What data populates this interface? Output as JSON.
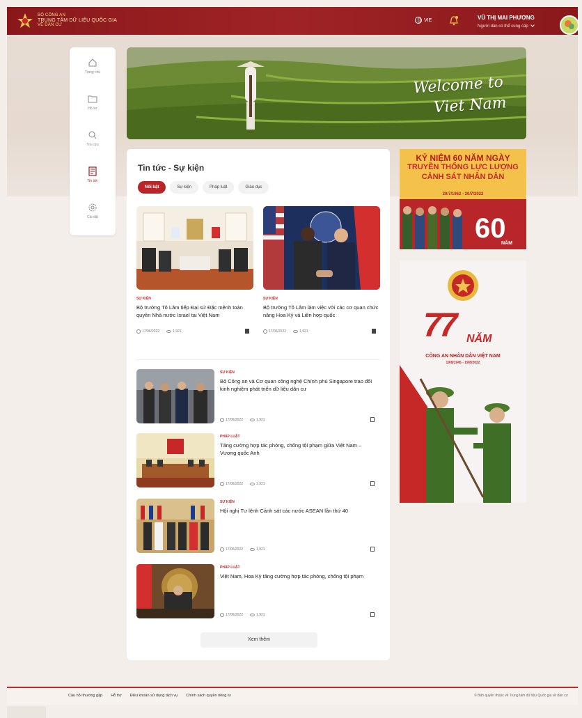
{
  "header": {
    "org_line1": "BỘ CÔNG AN",
    "org_line2": "TRUNG TÂM DỮ LIỆU QUỐC GIA",
    "org_line3": "VỀ DÂN CƯ",
    "language": "VIE",
    "user_name": "VŨ THỊ MAI PHƯƠNG",
    "user_role": "Người dân có thể cung cấp"
  },
  "sidebar": {
    "items": [
      {
        "label": "Trang chủ",
        "icon": "home-icon"
      },
      {
        "label": "Hồ sơ",
        "icon": "folder-icon"
      },
      {
        "label": "Tra cứu",
        "icon": "search-icon"
      },
      {
        "label": "Tin tức",
        "icon": "news-icon"
      },
      {
        "label": "Cài đặt",
        "icon": "gear-icon"
      }
    ]
  },
  "hero": {
    "line1": "Welcome to",
    "line2": "Viet Nam"
  },
  "news": {
    "title": "Tin tức - Sự kiện",
    "tabs": [
      "Nổi bật",
      "Sự kiện",
      "Pháp luật",
      "Giáo dục"
    ],
    "featured": [
      {
        "tag": "SỰ KIỆN",
        "title": "Bộ trưởng Tô Lâm tiếp Đại sứ Đặc mệnh toàn quyền Nhà nước Israel tại Việt Nam",
        "date": "17/06/2022",
        "views": "1,921"
      },
      {
        "tag": "SỰ KIỆN",
        "title": "Bộ trưởng Tô Lâm làm việc với các cơ quan chức năng Hoa Kỳ và Liên hợp quốc",
        "date": "17/06/2022",
        "views": "1,921"
      }
    ],
    "list": [
      {
        "tag": "SỰ KIỆN",
        "title": "Bộ Công an và Cơ quan công nghệ Chính phủ Singapore trao đổi kinh nghiệm phát triển dữ liệu dân cư",
        "date": "17/06/2022",
        "views": "1,921"
      },
      {
        "tag": "PHÁP LUẬT",
        "title": "Tăng cường hợp tác phòng, chống tội phạm giữa Việt Nam – Vương quốc Anh",
        "date": "17/06/2022",
        "views": "1,921"
      },
      {
        "tag": "SỰ KIỆN",
        "title": "Hội nghị Tư lệnh Cảnh sát các nước ASEAN lần thứ 40",
        "date": "17/06/2022",
        "views": "1,921"
      },
      {
        "tag": "PHÁP LUẬT",
        "title": "Việt Nam, Hoa Kỳ tăng cường hợp tác phòng, chống tội phạm",
        "date": "17/06/2022",
        "views": "1,921"
      }
    ],
    "more_label": "Xem thêm"
  },
  "ads": {
    "ad1": {
      "line1": "KỶ NIỆM 60 NĂM NGÀY",
      "line2": "TRUYỀN THỐNG LỰC LƯỢNG",
      "line3": "CẢNH SÁT NHÂN DÂN",
      "dates": "20/7/1962 - 20/7/2022",
      "number": "60",
      "unit": "NĂM"
    },
    "ad2": {
      "number": "77",
      "unit": "NĂM",
      "subtitle": "CÔNG AN NHÂN DÂN VIỆT NAM",
      "dates": "19/8/1945 - 19/8/2022"
    }
  },
  "footer": {
    "links": [
      "Câu hỏi thường gặp",
      "Hỗ trợ",
      "Điều khoản sử dụng dịch vụ",
      "Chính sách quyền riêng tư"
    ],
    "copyright": "© Bản quyền thuộc về Trung tâm dữ liệu Quốc gia về dân cư"
  },
  "colors": {
    "brand_red": "#9e1c20",
    "accent_gold": "#f4c24a"
  }
}
